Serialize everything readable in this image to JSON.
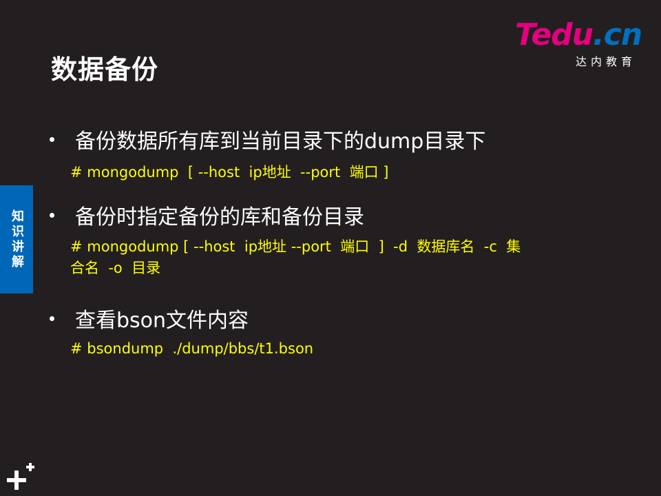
{
  "slide": {
    "title": "数据备份"
  },
  "logo": {
    "brand_t": "T",
    "brand_edu": "edu",
    "brand_dot": ".",
    "brand_cn": "cn",
    "subtitle": "达内教育",
    "colors": {
      "pink": "#e4007f",
      "blue": "#0070c0"
    }
  },
  "side_tab": {
    "label": "知识讲解",
    "color": "#0067b8"
  },
  "items": [
    {
      "bullet": "备份数据所有库到当前目录下的dump目录下",
      "command": "# mongodump  [ --host  ip地址  --port  端口 ]"
    },
    {
      "bullet": "备份时指定备份的库和备份目录",
      "command_line1": "# mongodump [ --host  ip地址 --port  端口  ]  -d  数据库名  -c  集",
      "command_line2": "合名  -o  目录"
    },
    {
      "bullet": "查看bson文件内容",
      "command": "# bsondump  ./dump/bbs/t1.bson"
    }
  ],
  "colors": {
    "background": "#231f20",
    "command_text": "#ffff00"
  },
  "icons": [
    "plus-icon"
  ]
}
